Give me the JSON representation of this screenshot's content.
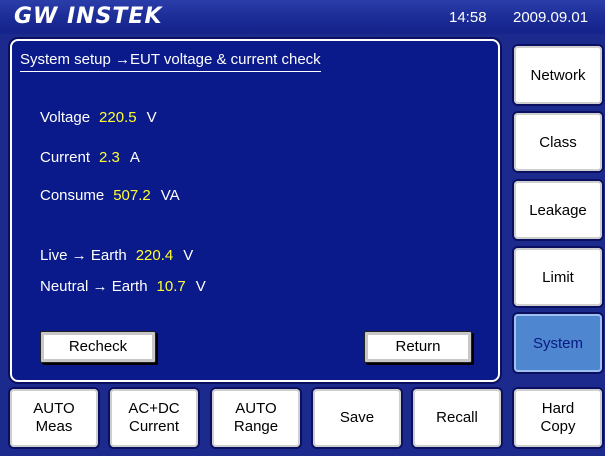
{
  "header": {
    "logo": "GW INSTEK",
    "time": "14:58",
    "date": "2009.09.01"
  },
  "panel": {
    "title": "System setup →EUT voltage & current check",
    "voltage": {
      "label": "Voltage",
      "value": "220.5",
      "unit": "V"
    },
    "current": {
      "label": "Current",
      "value": "2.3",
      "unit": "A"
    },
    "consume": {
      "label": "Consume",
      "value": "507.2",
      "unit": "VA"
    },
    "live_earth": {
      "label": "Live → Earth",
      "value": "220.4",
      "unit": "V"
    },
    "neutral_earth": {
      "label": "Neutral → Earth",
      "value": "10.7",
      "unit": "V"
    },
    "recheck_label": "Recheck",
    "return_label": "Return"
  },
  "side_menu": {
    "network": "Network",
    "class": "Class",
    "leakage": "Leakage",
    "limit": "Limit",
    "system": "System",
    "active": "System"
  },
  "bottom_bar": {
    "auto_meas": [
      "AUTO",
      "Meas"
    ],
    "acdc_current": [
      "AC+DC",
      "Current"
    ],
    "auto_range": [
      "AUTO",
      "Range"
    ],
    "save": "Save",
    "recall": "Recall",
    "hard_copy": [
      "Hard",
      "Copy"
    ]
  },
  "colors": {
    "background": "#1b2a8c",
    "panel": "#0a1a8a",
    "value_text": "#ffff33",
    "active_button": "#4f86d0"
  }
}
